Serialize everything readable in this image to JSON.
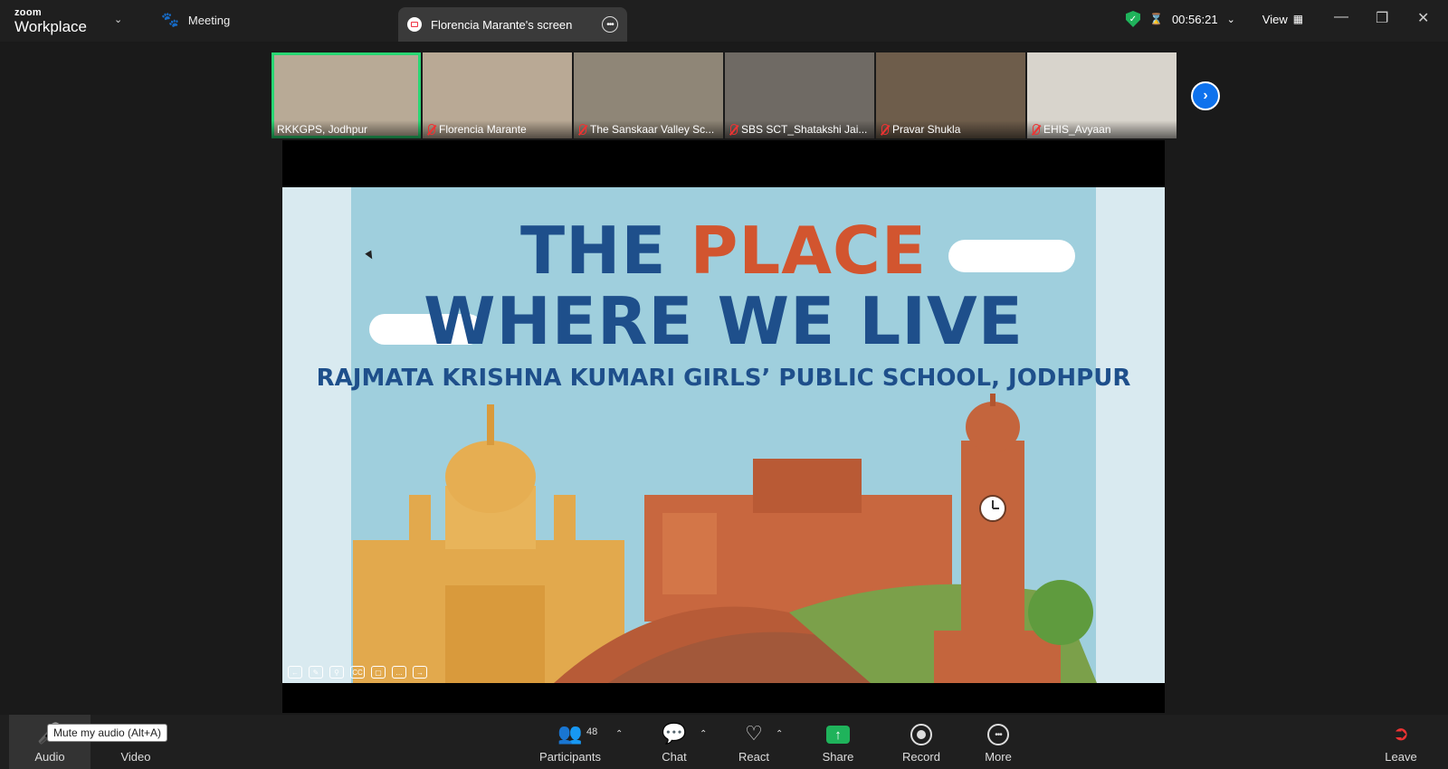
{
  "app": {
    "logo_small": "zoom",
    "logo_big": "Workplace",
    "meeting_tab": "Meeting",
    "screen_tab": "Florencia Marante's screen",
    "timer": "00:56:21",
    "view_label": "View"
  },
  "participants_strip": [
    {
      "name": "RKKGPS, Jodhpur",
      "muted": false,
      "active": true,
      "bg": "#b8aa96"
    },
    {
      "name": "Florencia Marante",
      "muted": true,
      "active": false,
      "bg": "#b9a995"
    },
    {
      "name": "The Sanskaar Valley Sc...",
      "muted": true,
      "active": false,
      "bg": "#8f8677"
    },
    {
      "name": "SBS SCT_Shatakshi Jai...",
      "muted": true,
      "active": false,
      "bg": "#6f6a64"
    },
    {
      "name": "Pravar Shukla",
      "muted": true,
      "active": false,
      "bg": "#6e5d4b"
    },
    {
      "name": "EHIS_Avyaan",
      "muted": true,
      "active": false,
      "bg": "#d8d4cc"
    }
  ],
  "slide": {
    "title_part1": "THE ",
    "title_accent": "PLACE",
    "title_line2": "WHERE WE LIVE",
    "subtitle": "RAJMATA KRISHNA KUMARI GIRLS’ PUBLIC SCHOOL, JODHPUR",
    "colors": {
      "title": "#1e4f8b",
      "accent": "#d2552f",
      "background": "#9fcfdd"
    }
  },
  "toolbar": {
    "audio": "Audio",
    "video": "Video",
    "participants": "Participants",
    "participant_count": "48",
    "chat": "Chat",
    "react": "React",
    "share": "Share",
    "record": "Record",
    "more": "More",
    "leave": "Leave",
    "tooltip": "Mute my audio (Alt+A)"
  }
}
